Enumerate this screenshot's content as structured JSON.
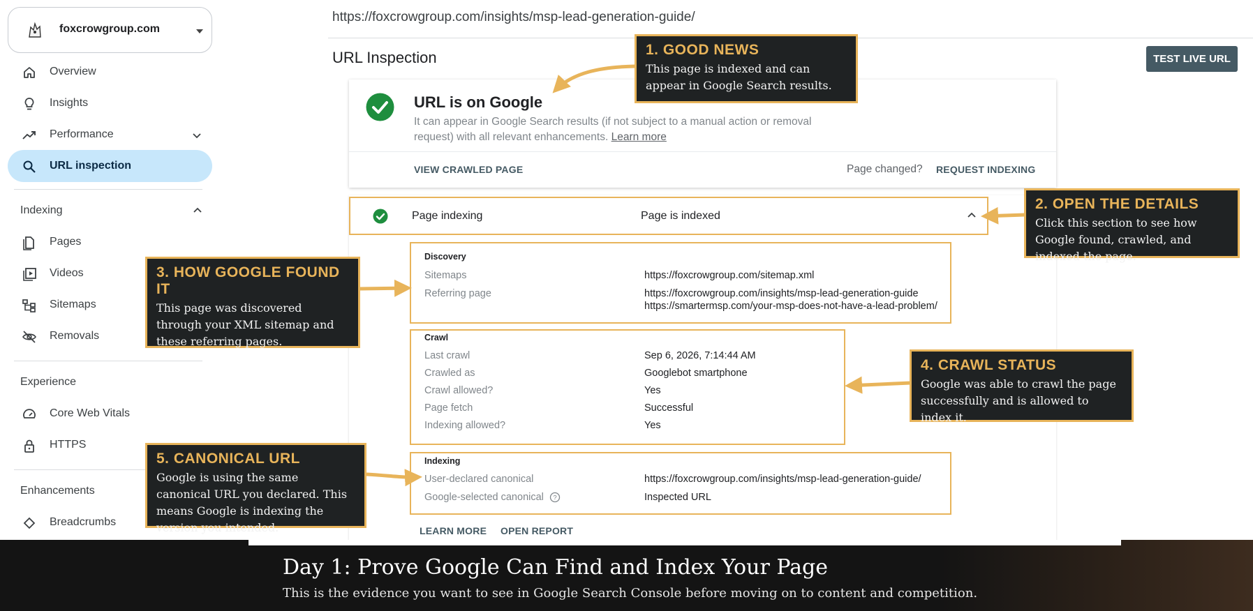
{
  "sidebar": {
    "property": {
      "name": "foxcrowgroup.com",
      "icon": "fox-logo-icon"
    },
    "nav": [
      {
        "label": "Overview",
        "icon": "home-icon"
      },
      {
        "label": "Insights",
        "icon": "lightbulb-icon"
      },
      {
        "label": "Performance",
        "icon": "trending-up-icon",
        "expandable": true
      },
      {
        "label": "URL inspection",
        "icon": "search-icon",
        "active": true
      }
    ],
    "indexing": {
      "heading": "Indexing",
      "items": [
        {
          "label": "Pages",
          "icon": "pages-icon"
        },
        {
          "label": "Videos",
          "icon": "video-icon"
        },
        {
          "label": "Sitemaps",
          "icon": "sitemap-icon"
        },
        {
          "label": "Removals",
          "icon": "eye-off-icon"
        }
      ]
    },
    "experience": {
      "heading": "Experience",
      "items": [
        {
          "label": "Core Web Vitals",
          "icon": "gauge-icon"
        },
        {
          "label": "HTTPS",
          "icon": "lock-icon"
        }
      ]
    },
    "enhancements": {
      "heading": "Enhancements",
      "items": [
        {
          "label": "Breadcrumbs",
          "icon": "diamond-icon"
        }
      ]
    }
  },
  "main": {
    "inspected_url": "https://foxcrowgroup.com/insights/msp-lead-generation-guide/",
    "title": "URL Inspection",
    "test_live_url": "TEST LIVE URL",
    "status_card": {
      "title": "URL is on Google",
      "description": "It can appear in Google Search results (if not subject to a manual action or removal request) with all relevant enhancements.",
      "learn_more": "Learn more",
      "view_crawled": "VIEW CRAWLED PAGE",
      "page_changed": "Page changed?",
      "request_indexing": "REQUEST INDEXING"
    },
    "page_indexing": {
      "label": "Page indexing",
      "status": "Page is indexed"
    },
    "discovery": {
      "title": "Discovery",
      "sitemaps_label": "Sitemaps",
      "sitemaps_value": "https://foxcrowgroup.com/sitemap.xml",
      "referring_label": "Referring page",
      "referring_value_1": "https://foxcrowgroup.com/insights/msp-lead-generation-guide",
      "referring_value_2": "https://smartermsp.com/your-msp-does-not-have-a-lead-problem/"
    },
    "crawl": {
      "title": "Crawl",
      "rows": [
        {
          "label": "Last crawl",
          "value": "Sep 6, 2026, 7:14:44 AM"
        },
        {
          "label": "Crawled as",
          "value": "Googlebot smartphone"
        },
        {
          "label": "Crawl allowed?",
          "value": "Yes"
        },
        {
          "label": "Page fetch",
          "value": "Successful"
        },
        {
          "label": "Indexing allowed?",
          "value": "Yes"
        }
      ]
    },
    "indexing": {
      "title": "Indexing",
      "user_label": "User-declared canonical",
      "user_value": "https://foxcrowgroup.com/insights/msp-lead-generation-guide/",
      "google_label": "Google-selected canonical",
      "google_value": "Inspected URL"
    },
    "footer": {
      "learn_more": "LEARN MORE",
      "open_report": "OPEN REPORT"
    }
  },
  "callouts": {
    "c1": {
      "title": "1. GOOD NEWS",
      "body": "This page is indexed and can appear in Google Search results."
    },
    "c2": {
      "title": "2. OPEN THE DETAILS",
      "body": "Click this section to see how Google found, crawled, and indexed the page."
    },
    "c3": {
      "title": "3. HOW GOOGLE FOUND IT",
      "body": "This page was discovered through your XML sitemap and these referring pages."
    },
    "c4": {
      "title": "4. CRAWL STATUS",
      "body": "Google was able to crawl the page successfully and is allowed to index it."
    },
    "c5": {
      "title": "5. CANONICAL URL",
      "body": "Google is using the same canonical URL you declared. This means Google is indexing the version you intended."
    }
  },
  "banner": {
    "title": "Day 1: Prove Google Can Find and Index Your Page",
    "subtitle": "This is the evidence you want to see in Google Search Console before moving on to content and competition."
  },
  "colors": {
    "accent_gold": "#e8b45a",
    "success_green": "#1e8e3e",
    "active_nav": "#c7e7fb",
    "button_slate": "#455a64"
  }
}
